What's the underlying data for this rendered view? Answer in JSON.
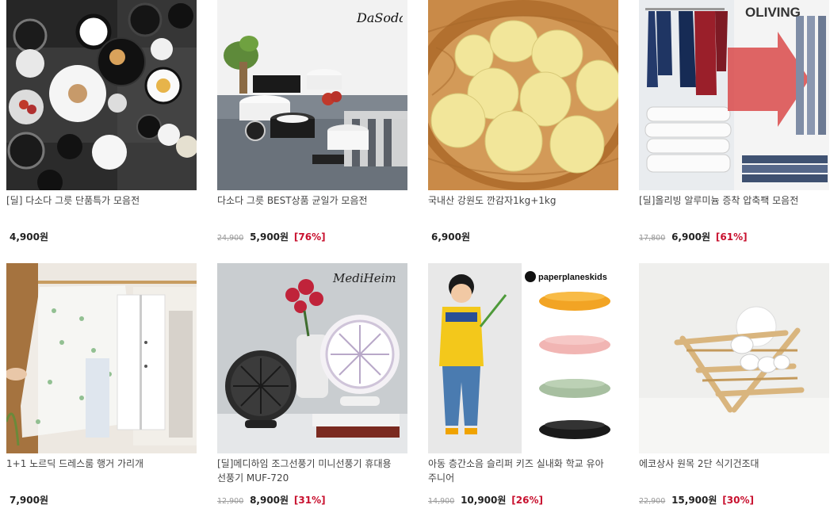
{
  "products": [
    {
      "title": "[딜] 다소다 그릇 단품특가 모음전",
      "original_price": "",
      "price": "4,900원",
      "discount": ""
    },
    {
      "title": "다소다 그릇 BEST상품 균일가 모음전",
      "original_price": "24,900",
      "price": "5,900원",
      "discount": "[76%]",
      "brand": "DaSoda"
    },
    {
      "title": "국내산 강원도 깐감자1kg+1kg",
      "original_price": "",
      "price": "6,900원",
      "discount": ""
    },
    {
      "title": "[딜]올리빙 알루미늄 증착 압축팩 모음전",
      "original_price": "17,800",
      "price": "6,900원",
      "discount": "[61%]",
      "brand": "OLIVING"
    },
    {
      "title": "1+1 노르딕 드레스룸 행거 가리개",
      "original_price": "",
      "price": "7,900원",
      "discount": ""
    },
    {
      "title": "[딜]메디하임 조그선풍기 미니선풍기 휴대용 선풍기 MUF-720",
      "original_price": "12,900",
      "price": "8,900원",
      "discount": "[31%]",
      "brand": "MediHeim"
    },
    {
      "title": "아동 층간소음 슬리퍼 키즈 실내화 학교 유아 주니어",
      "original_price": "14,900",
      "price": "10,900원",
      "discount": "[26%]",
      "brand": "paperplaneskids"
    },
    {
      "title": "에코상사 원목 2단 식기건조대",
      "original_price": "22,900",
      "price": "15,900원",
      "discount": "[30%]"
    }
  ],
  "colors": {
    "discount": "#c8102e",
    "price": "#222222",
    "original": "#999999"
  }
}
